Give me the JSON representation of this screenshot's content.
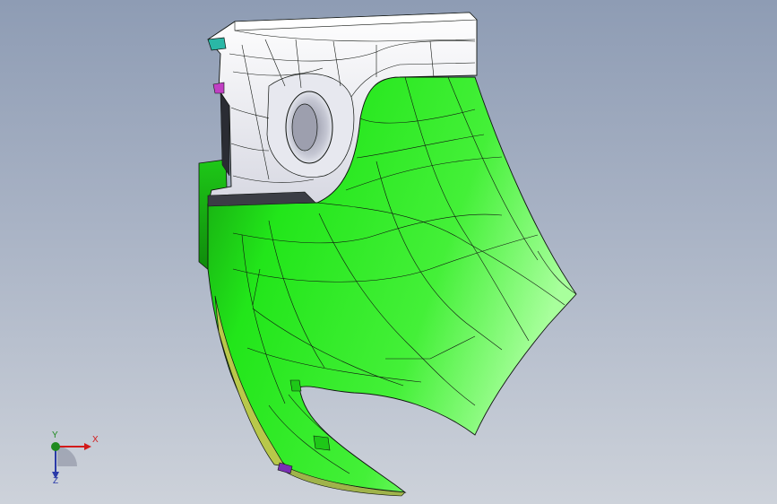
{
  "viewport": {
    "background_top": "#8e9cb4",
    "background_bottom": "#cdd2da"
  },
  "model": {
    "surface_color": "#22e61a",
    "surface_highlight": "#a8ff9c",
    "surface_shadow": "#139a0e",
    "bracket_color": "#f4f4f8",
    "edge_color": "#101410",
    "accent_colors": [
      "#c13fc4",
      "#2ab7a6",
      "#c9c83a"
    ]
  },
  "triad": {
    "x_label": "X",
    "y_label": "Y",
    "z_label": "Z",
    "x_color": "#d21a1a",
    "y_color": "#1f8a1f",
    "z_color": "#2a3aa8"
  }
}
